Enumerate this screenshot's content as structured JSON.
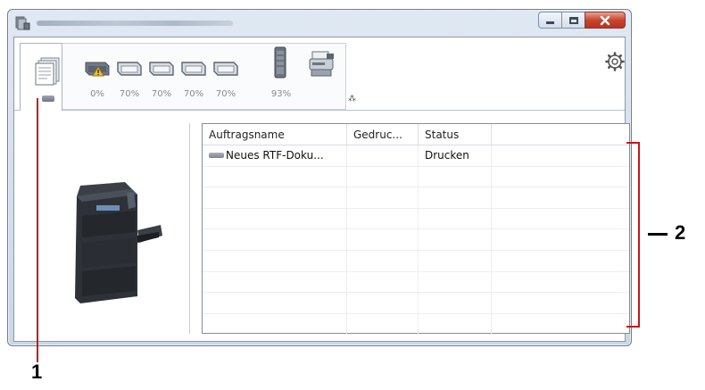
{
  "window": {
    "title": "",
    "accent_close": "#c8452f"
  },
  "toolbar": {
    "trays": [
      {
        "label": "0%",
        "warning": true
      },
      {
        "label": "70%",
        "warning": false
      },
      {
        "label": "70%",
        "warning": false
      },
      {
        "label": "70%",
        "warning": false
      },
      {
        "label": "70%",
        "warning": false
      }
    ],
    "toner": {
      "label": "93%"
    },
    "icons": {
      "jobs": "document-stack-icon",
      "device": "printer-device-icon",
      "settings": "gear-icon"
    }
  },
  "joblist": {
    "columns": [
      "Auftragsname",
      "Gedruc...",
      "Status",
      ""
    ],
    "rows": [
      {
        "name": "Neues RTF-Doku...",
        "printed": "",
        "status": "Drucken"
      },
      {
        "name": "",
        "printed": "",
        "status": ""
      },
      {
        "name": "",
        "printed": "",
        "status": ""
      },
      {
        "name": "",
        "printed": "",
        "status": ""
      },
      {
        "name": "",
        "printed": "",
        "status": ""
      },
      {
        "name": "",
        "printed": "",
        "status": ""
      },
      {
        "name": "",
        "printed": "",
        "status": ""
      },
      {
        "name": "",
        "printed": "",
        "status": ""
      },
      {
        "name": "",
        "printed": "",
        "status": ""
      }
    ]
  },
  "callouts": {
    "one": "1",
    "two": "2"
  }
}
